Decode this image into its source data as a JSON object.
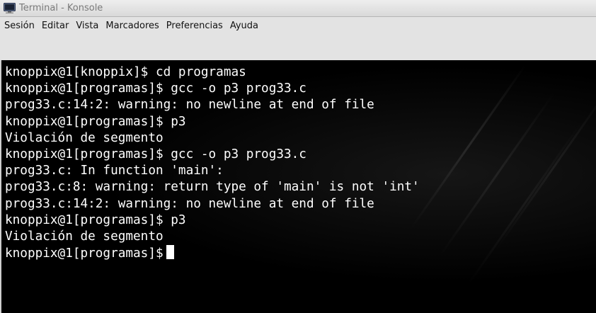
{
  "window": {
    "title": "Terminal - Konsole",
    "icon": "terminal-icon"
  },
  "menu": {
    "items": [
      "Sesión",
      "Editar",
      "Vista",
      "Marcadores",
      "Preferencias",
      "Ayuda"
    ]
  },
  "terminal": {
    "lines": [
      "knoppix@1[knoppix]$ cd programas",
      "knoppix@1[programas]$ gcc -o p3 prog33.c",
      "prog33.c:14:2: warning: no newline at end of file",
      "knoppix@1[programas]$ p3",
      "Violación de segmento",
      "knoppix@1[programas]$ gcc -o p3 prog33.c",
      "prog33.c: In function 'main':",
      "prog33.c:8: warning: return type of 'main' is not 'int'",
      "prog33.c:14:2: warning: no newline at end of file",
      "knoppix@1[programas]$ p3",
      "Violación de segmento"
    ],
    "prompt": "knoppix@1[programas]$",
    "background_color": "#000000",
    "text_color": "#ffffff"
  }
}
